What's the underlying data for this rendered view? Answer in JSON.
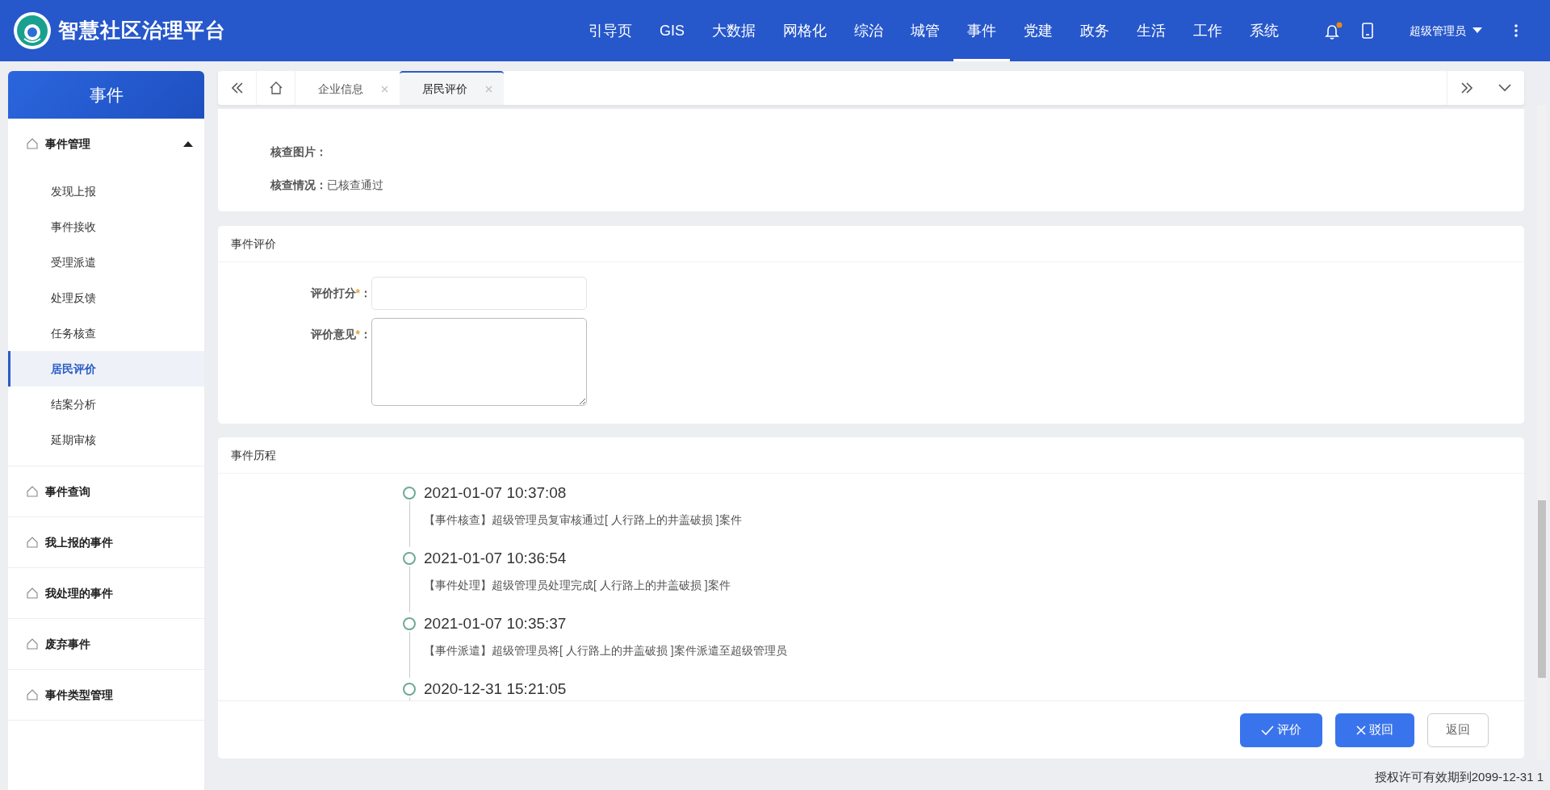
{
  "header": {
    "logo_text": "智慧社区治理平台",
    "nav": [
      {
        "label": "引导页",
        "selected": false
      },
      {
        "label": "GIS",
        "selected": false
      },
      {
        "label": "大数据",
        "selected": false
      },
      {
        "label": "网格化",
        "selected": false
      },
      {
        "label": "综治",
        "selected": false
      },
      {
        "label": "城管",
        "selected": false
      },
      {
        "label": "事件",
        "selected": true
      },
      {
        "label": "党建",
        "selected": false
      },
      {
        "label": "政务",
        "selected": false
      },
      {
        "label": "生活",
        "selected": false
      },
      {
        "label": "工作",
        "selected": false
      },
      {
        "label": "系统",
        "selected": false
      }
    ],
    "notification_dot": true,
    "user": "超级管理员"
  },
  "sidebar": {
    "title": "事件",
    "groups": [
      {
        "label": "事件管理",
        "expanded": true,
        "children": [
          {
            "label": "发现上报",
            "selected": false
          },
          {
            "label": "事件接收",
            "selected": false
          },
          {
            "label": "受理派遣",
            "selected": false
          },
          {
            "label": "处理反馈",
            "selected": false
          },
          {
            "label": "任务核查",
            "selected": false
          },
          {
            "label": "居民评价",
            "selected": true
          },
          {
            "label": "结案分析",
            "selected": false
          },
          {
            "label": "延期审核",
            "selected": false
          }
        ]
      },
      {
        "label": "事件查询",
        "expanded": false
      },
      {
        "label": "我上报的事件",
        "expanded": false
      },
      {
        "label": "我处理的事件",
        "expanded": false
      },
      {
        "label": "废弃事件",
        "expanded": false
      },
      {
        "label": "事件类型管理",
        "expanded": false
      }
    ]
  },
  "tabs": [
    {
      "label": "企业信息",
      "selected": false
    },
    {
      "label": "居民评价",
      "selected": true
    }
  ],
  "check_section": {
    "fields": [
      {
        "label": "核查图片："
      },
      {
        "label": "核查情况：",
        "value": "已核查通过"
      }
    ]
  },
  "evaluation": {
    "title": "事件评价",
    "fields": [
      {
        "kind": "input",
        "label": "评价打分",
        "required_mark": "*",
        "suffix": "："
      },
      {
        "kind": "textarea",
        "label": "评价意见",
        "required_mark": "*",
        "suffix": "："
      }
    ]
  },
  "history": {
    "title": "事件历程",
    "entries": [
      {
        "time": "2021-01-07 10:37:08",
        "text": "【事件核查】超级管理员复审核通过[ 人行路上的井盖破损 ]案件"
      },
      {
        "time": "2021-01-07 10:36:54",
        "text": "【事件处理】超级管理员处理完成[ 人行路上的井盖破损 ]案件"
      },
      {
        "time": "2021-01-07 10:35:37",
        "text": "【事件派遣】超级管理员将[ 人行路上的井盖破损 ]案件派遣至超级管理员"
      },
      {
        "time": "2020-12-31 15:21:05"
      }
    ]
  },
  "actions": [
    {
      "kind": "confirm",
      "label": "评价"
    },
    {
      "kind": "reject",
      "label": "驳回"
    },
    {
      "kind": "back",
      "label": "返回"
    }
  ],
  "footer": {
    "license": "授权许可有效期到2099-12-31 1"
  }
}
